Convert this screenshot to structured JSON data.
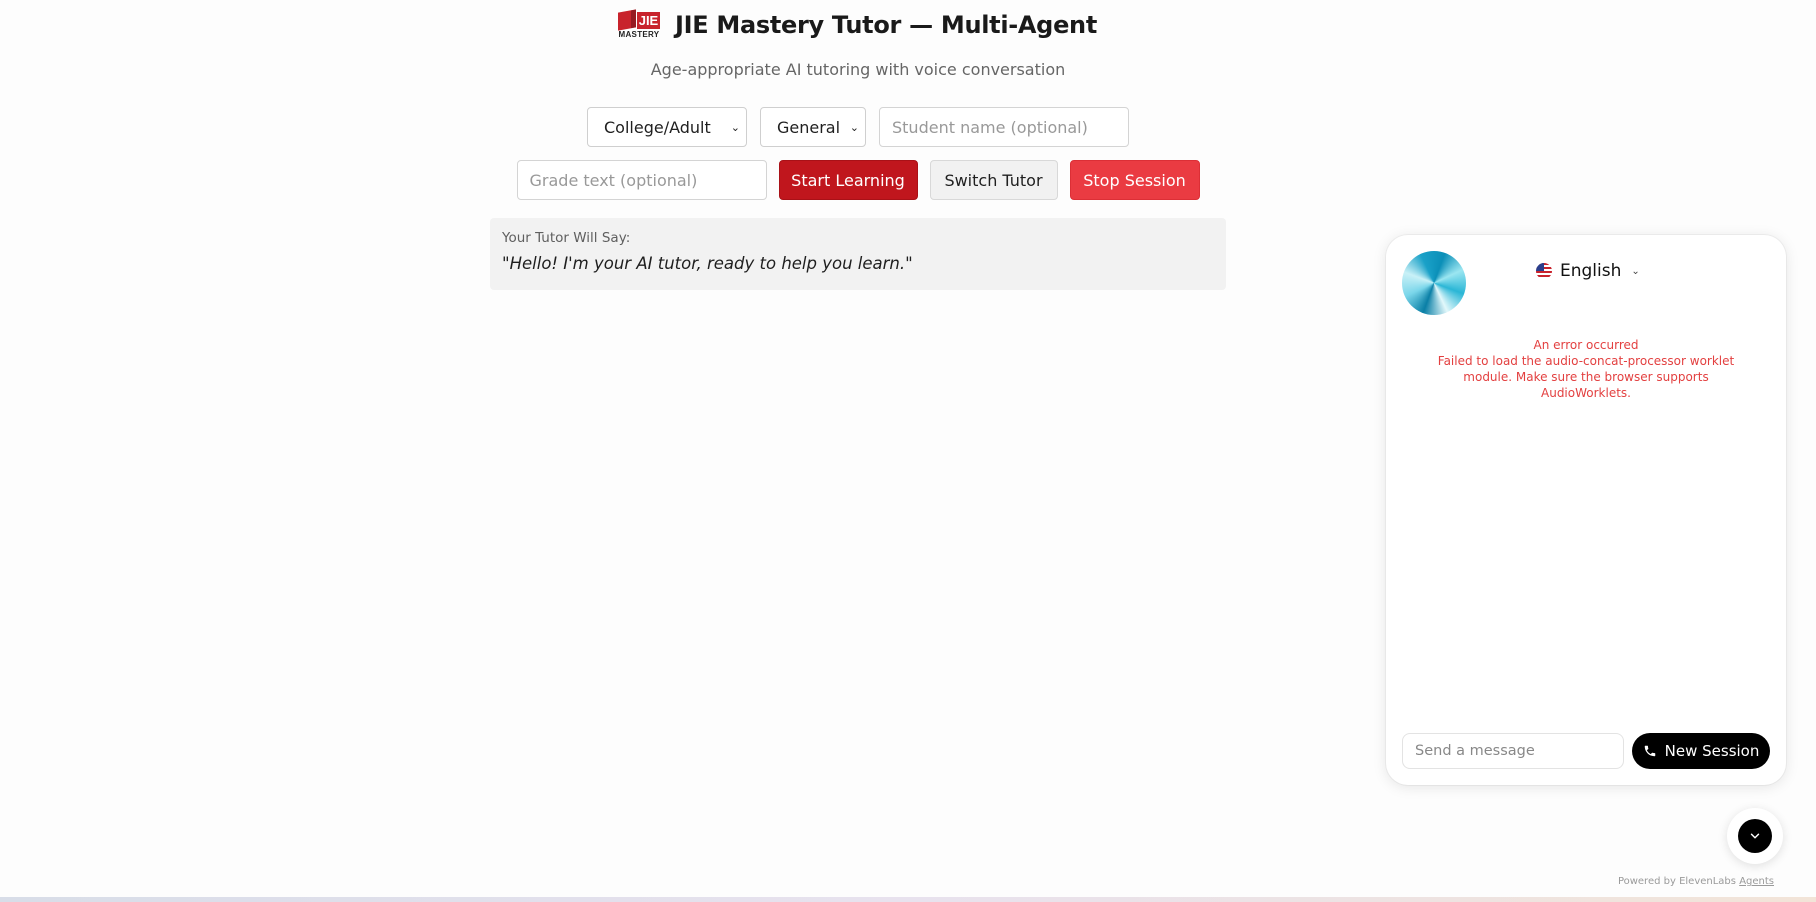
{
  "header": {
    "logo_text": "JIE",
    "logo_sub": "MASTERY",
    "title": "JIE Mastery Tutor — Multi-Agent",
    "subtitle": "Age-appropriate AI tutoring with voice conversation"
  },
  "controls": {
    "level_select": "College/Adult",
    "subject_select": "General",
    "student_name_placeholder": "Student name (optional)",
    "grade_text_placeholder": "Grade text (optional)",
    "start_label": "Start Learning",
    "switch_label": "Switch Tutor",
    "stop_label": "Stop Session"
  },
  "tutor_say": {
    "label": "Your Tutor Will Say:",
    "text": "\"Hello! I'm your AI tutor, ready to help you learn.\""
  },
  "widget": {
    "language": "English",
    "error_title": "An error occurred",
    "error_message": "Failed to load the audio-concat-processor worklet module. Make sure the browser supports AudioWorklets.",
    "message_placeholder": "Send a message",
    "new_session_label": "New Session"
  },
  "footer": {
    "powered_prefix": "Powered by ElevenLabs",
    "powered_link": "Agents"
  },
  "colors": {
    "start_button": "#c0161d",
    "stop_button": "#ea3b42",
    "error_text": "#e34040",
    "new_session_bg": "#000000"
  },
  "icons": [
    "jie-mastery-logo",
    "chevron-down-icon",
    "us-flag-icon",
    "phone-icon",
    "chevron-down-icon"
  ]
}
